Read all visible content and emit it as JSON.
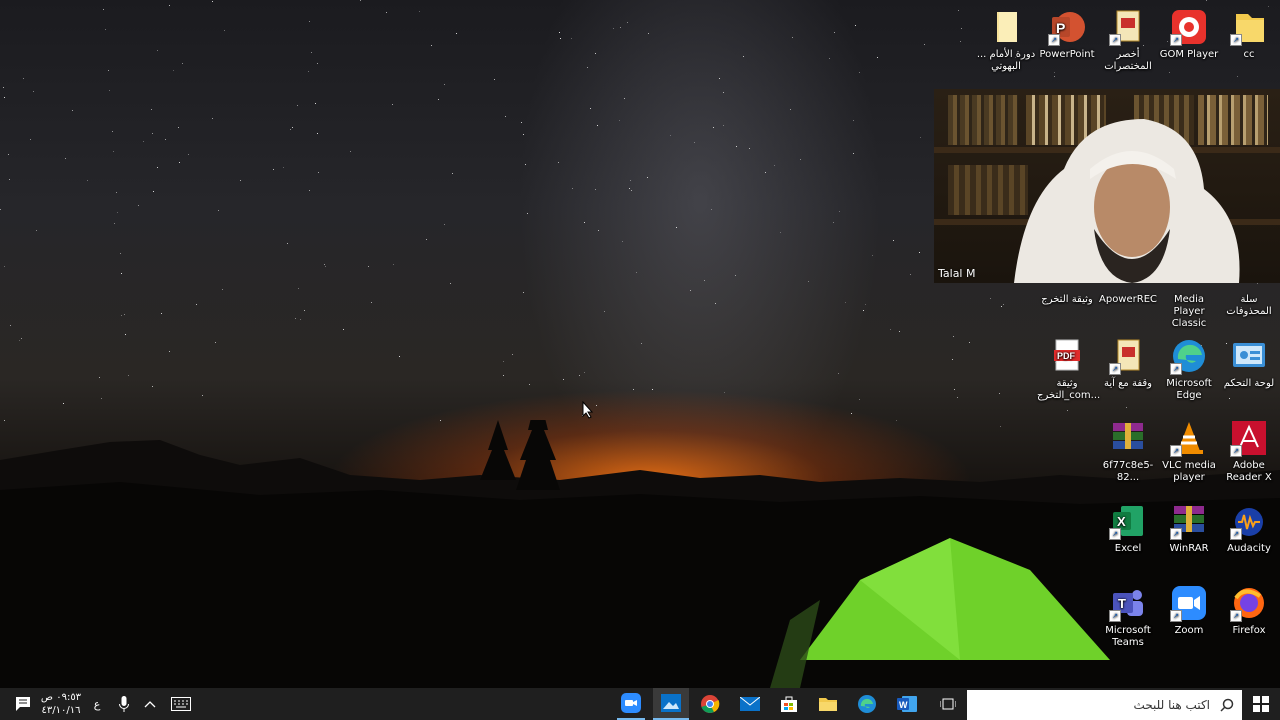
{
  "desktop": {
    "icons": [
      {
        "label": "cc",
        "icon": "folder-icon"
      },
      {
        "label": "GOM Player",
        "icon": "gom-player-icon"
      },
      {
        "label": "أخصر المختصرات",
        "icon": "document-icon"
      },
      {
        "label": "PowerPoint",
        "icon": "powerpoint-icon"
      },
      {
        "label": "دورة الأمام ... البهوتي",
        "icon": "folder-icon"
      },
      {
        "label": "سلة المحذوفات",
        "icon": "recycle-bin-icon"
      },
      {
        "label": "Media Player Classic",
        "icon": "media-player-icon"
      },
      {
        "label": "ApowerREC",
        "icon": "apowerrec-icon"
      },
      {
        "label": "وثيقة التخرج",
        "icon": "document-icon"
      },
      {
        "label": "لوحة التحكم",
        "icon": "control-panel-icon"
      },
      {
        "label": "Microsoft Edge",
        "icon": "edge-icon"
      },
      {
        "label": "وقفة مع آية",
        "icon": "document-icon"
      },
      {
        "label": "وثيقة التخرج_com...",
        "icon": "pdf-icon"
      },
      {
        "label": "Adobe Reader X",
        "icon": "adobe-reader-icon"
      },
      {
        "label": "VLC media player",
        "icon": "vlc-icon"
      },
      {
        "label": "6f77c8e5-82...",
        "icon": "winrar-archive-icon"
      },
      {
        "label": "Audacity",
        "icon": "audacity-icon"
      },
      {
        "label": "WinRAR",
        "icon": "winrar-icon"
      },
      {
        "label": "Excel",
        "icon": "excel-icon"
      },
      {
        "label": "Firefox",
        "icon": "firefox-icon"
      },
      {
        "label": "Zoom",
        "icon": "zoom-icon"
      },
      {
        "label": "Microsoft Teams",
        "icon": "teams-icon"
      }
    ]
  },
  "webcam": {
    "participant_name": "Talal M"
  },
  "taskbar": {
    "search_placeholder": "اكتب هنا للبحث",
    "clock_time": "٠٩:٥٣ ص",
    "clock_date": "٤٣/١٠/١٦",
    "language": "ع",
    "apps": [
      "zoom-icon",
      "photos-icon",
      "chrome-icon",
      "mail-icon",
      "store-icon",
      "file-explorer-icon",
      "edge-icon",
      "word-icon",
      "task-view-icon"
    ]
  },
  "colors": {
    "taskbar": "#1f1f1f",
    "tent": "#6fd12a",
    "sunset": "#ff7a18"
  }
}
